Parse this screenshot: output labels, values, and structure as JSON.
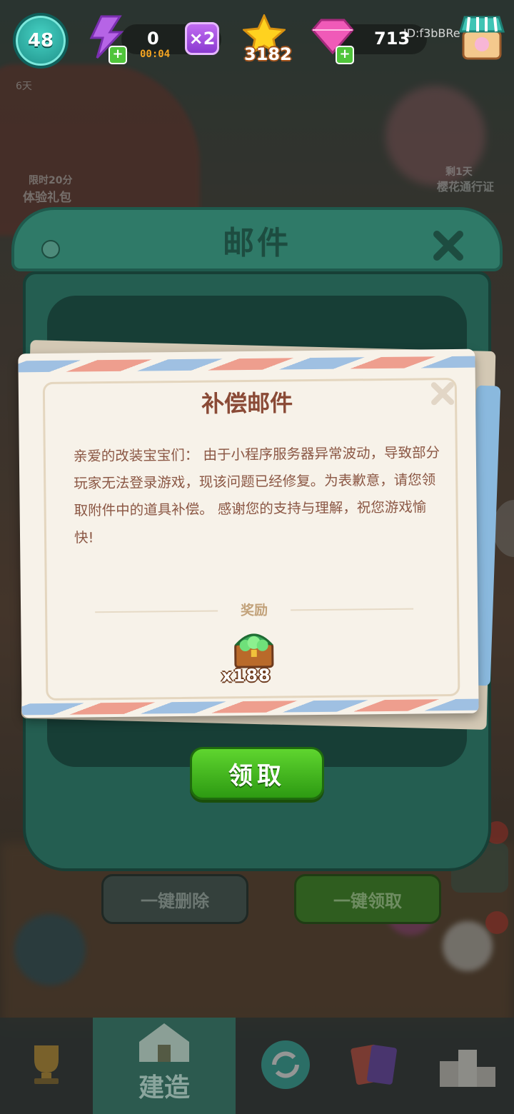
{
  "topbar": {
    "level": "48",
    "energy_value": "0",
    "energy_timer": "00:04",
    "multiplier": "×2",
    "stars": "3182",
    "gems": "713",
    "user_id": "ID:f3bBRe"
  },
  "side_events": {
    "left_top": "6天",
    "left_event_time": "限时20分",
    "left_event": "体验礼包",
    "right_event_days": "剩1天",
    "right_event": "樱花通行证"
  },
  "mail": {
    "title": "邮件",
    "letter_title": "补偿邮件",
    "letter_body": "亲爱的改装宝宝们： 由于小程序服务器异常波动，导致部分玩家无法登录游戏，现该问题已经修复。为表歉意，请您领取附件中的道具补偿。 感谢您的支持与理解，祝您游戏愉快!",
    "reward_label": "奖励",
    "reward_count": "x188",
    "claim_button": "领取",
    "delete_all_button": "一键删除",
    "claim_all_button": "一键领取"
  },
  "nav": {
    "build_label": "建造"
  },
  "colors": {
    "panel_green": "#2f7a68",
    "claim_green": "#3fb51c",
    "letter_text": "#8b5744"
  }
}
